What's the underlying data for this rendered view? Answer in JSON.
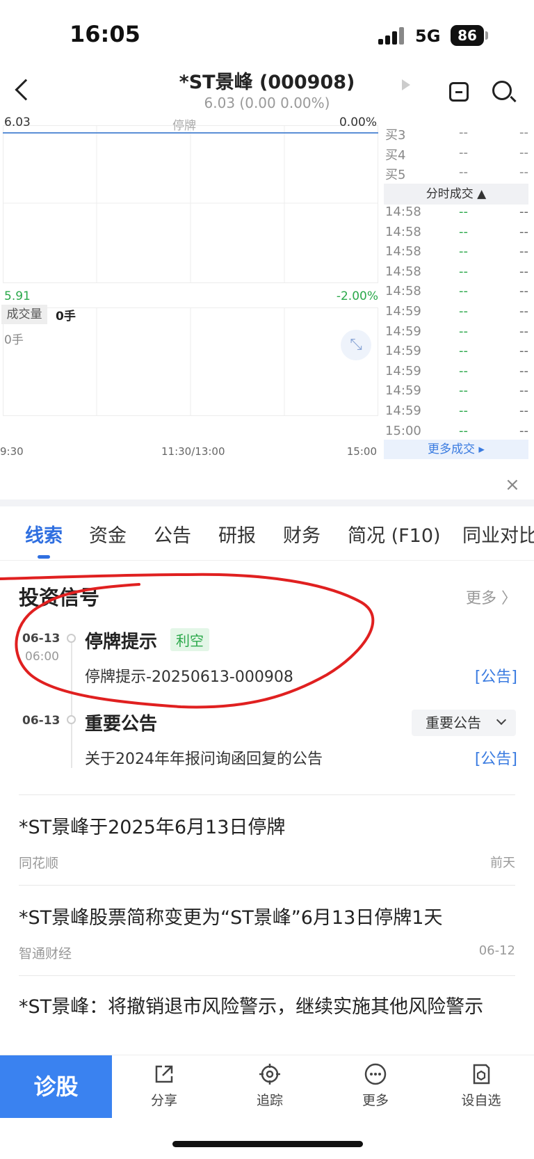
{
  "status": {
    "time": "16:05",
    "network": "5G",
    "battery": "86"
  },
  "header": {
    "title": "*ST景峰 (000908)",
    "subtitle": "6.03 (0.00 0.00%)"
  },
  "chart": {
    "price_high": "6.03",
    "status_text": "停牌",
    "pct_high": "0.00%",
    "price_low": "5.91",
    "pct_low": "-2.00%",
    "volume_label": "成交量",
    "volume_value": "0手",
    "volume_axis": "0手",
    "time_start": "9:30",
    "time_mid": "11:30/13:00",
    "time_end": "15:00"
  },
  "order_book": [
    {
      "label": "买3",
      "price": "--",
      "vol": "--"
    },
    {
      "label": "买4",
      "price": "--",
      "vol": "--"
    },
    {
      "label": "买5",
      "price": "--",
      "vol": "--"
    }
  ],
  "trades_header": "分时成交 ▲",
  "trades": [
    {
      "time": "14:58",
      "price": "--",
      "vol": "--"
    },
    {
      "time": "14:58",
      "price": "--",
      "vol": "--"
    },
    {
      "time": "14:58",
      "price": "--",
      "vol": "--"
    },
    {
      "time": "14:58",
      "price": "--",
      "vol": "--"
    },
    {
      "time": "14:58",
      "price": "--",
      "vol": "--"
    },
    {
      "time": "14:59",
      "price": "--",
      "vol": "--"
    },
    {
      "time": "14:59",
      "price": "--",
      "vol": "--"
    },
    {
      "time": "14:59",
      "price": "--",
      "vol": "--"
    },
    {
      "time": "14:59",
      "price": "--",
      "vol": "--"
    },
    {
      "time": "14:59",
      "price": "--",
      "vol": "--"
    },
    {
      "time": "14:59",
      "price": "--",
      "vol": "--"
    },
    {
      "time": "15:00",
      "price": "--",
      "vol": "--"
    }
  ],
  "more_trades": "更多成交 ▸",
  "tabs": [
    "线索",
    "资金",
    "公告",
    "研报",
    "财务",
    "简况 (F10)",
    "同业对比"
  ],
  "signals": {
    "title": "投资信号",
    "more": "更多 〉",
    "items": [
      {
        "date": "06-13",
        "time": "06:00",
        "title": "停牌提示",
        "tag": "利空",
        "desc": "停牌提示-20250613-000908",
        "link": "[公告]"
      },
      {
        "date": "06-13",
        "title": "重要公告",
        "select": "重要公告",
        "desc": "关于2024年年报问询函回复的公告",
        "link": "[公告]"
      }
    ]
  },
  "news": [
    {
      "title": "*ST景峰于2025年6月13日停牌",
      "source": "同花顺",
      "date": "前天"
    },
    {
      "title": "*ST景峰股票简称变更为“ST景峰”6月13日停牌1天",
      "source": "智通财经",
      "date": "06-12"
    },
    {
      "title": "*ST景峰：将撤销退市风险警示，继续实施其他风险警示"
    }
  ],
  "bottom": {
    "diagnose": "诊股",
    "share": "分享",
    "track": "追踪",
    "more": "更多",
    "watch": "设自选"
  },
  "colors": {
    "accent": "#2f6fe0",
    "up_green": "#2aa84a",
    "annotation": "#e02020"
  }
}
